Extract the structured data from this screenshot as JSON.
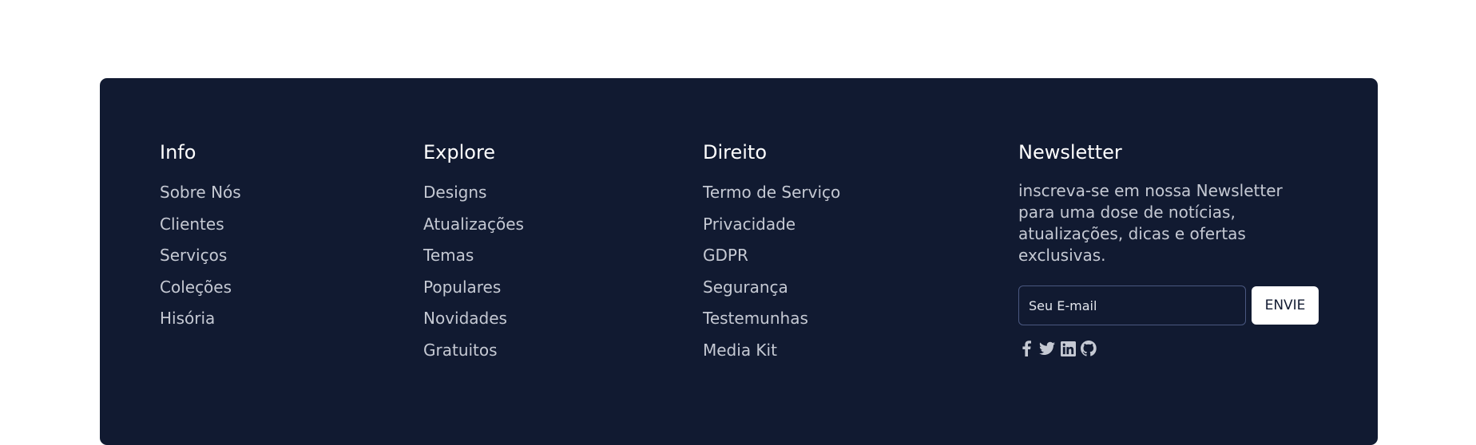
{
  "footer": {
    "info": {
      "title": "Info",
      "links": [
        "Sobre Nós",
        "Clientes",
        "Serviços",
        "Coleções",
        "Hisória"
      ]
    },
    "explore": {
      "title": "Explore",
      "links": [
        "Designs",
        "Atualizações",
        "Temas",
        "Populares",
        "Novidades",
        "Gratuitos"
      ]
    },
    "direito": {
      "title": "Direito",
      "links": [
        "Termo de Serviço",
        "Privacidade",
        "GDPR",
        "Segurança",
        "Testemunhas",
        "Media Kit"
      ]
    },
    "newsletter": {
      "title": "Newsletter",
      "text": "inscreva-se em nossa Newsletter para uma dose de notícias, atualizações, dicas e ofertas exclusivas.",
      "email_placeholder": "Seu E-mail",
      "email_value": "",
      "button_label": "ENVIE",
      "social_icons": [
        "facebook-icon",
        "twitter-icon",
        "linkedin-icon",
        "github-icon"
      ]
    }
  },
  "colors": {
    "footer_bg": "#111a31",
    "link_text": "#c5c9d3",
    "heading_text": "#ffffff",
    "button_bg": "#ffffff",
    "input_border": "#4a5880"
  }
}
